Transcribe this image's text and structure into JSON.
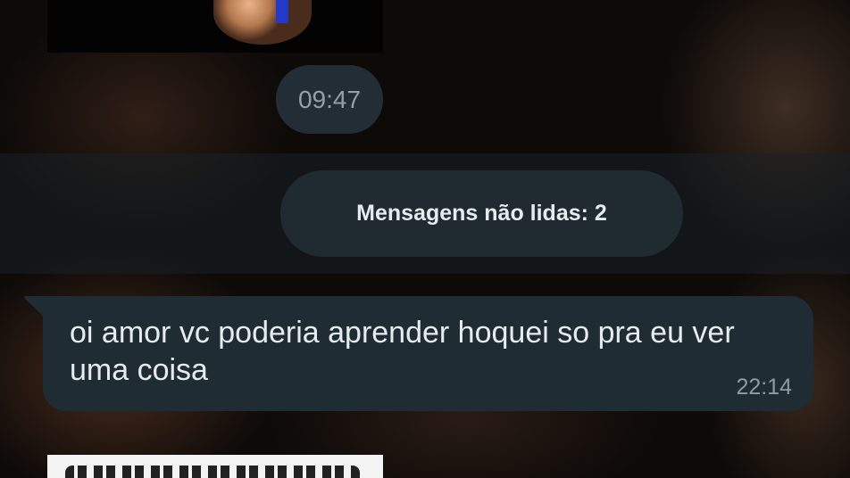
{
  "chat": {
    "previous_time": "09:47",
    "unread_banner": "Mensagens não lidas: 2",
    "messages": [
      {
        "text": "oi amor vc poderia aprender hoquei so pra eu ver uma coisa",
        "time": "22:14"
      }
    ]
  },
  "colors": {
    "bubble_incoming": "#1f2c34",
    "banner_pill": "#1f2a31",
    "text_primary": "#e6ebee",
    "text_secondary": "#8f9ba3"
  }
}
